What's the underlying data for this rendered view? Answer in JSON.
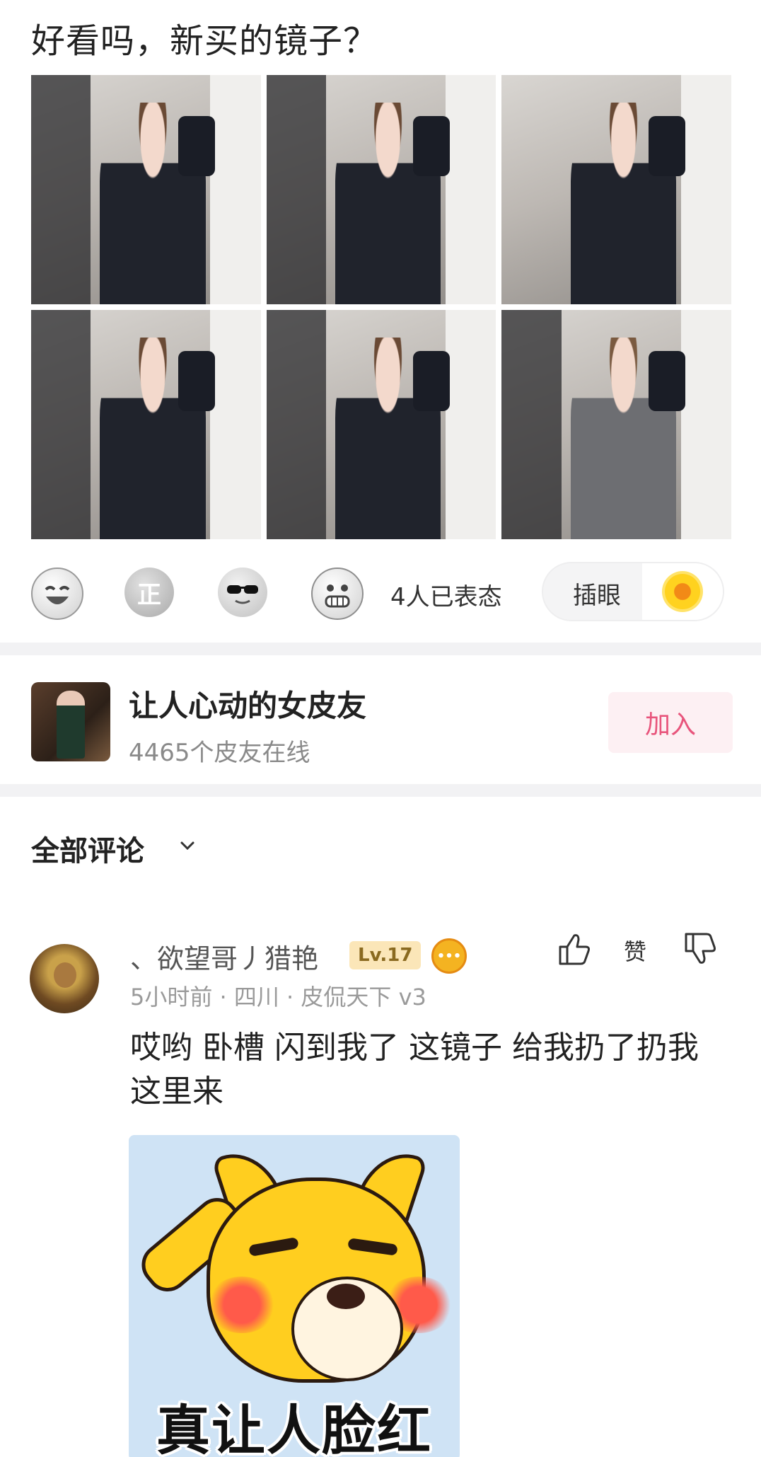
{
  "post": {
    "title": "好看吗，新买的镜子？",
    "photos": [
      "mirror-selfie",
      "mirror-selfie",
      "mirror-selfie",
      "mirror-selfie",
      "mirror-selfie",
      "mirror-selfie"
    ]
  },
  "reactions": {
    "emojis": [
      "laugh-emoji",
      "zheng-emoji",
      "cool-sunglasses-emoji",
      "grin-emoji"
    ],
    "zheng_glyph": "正",
    "count_text": "4人已表态",
    "chip_label": "插眼",
    "chip_icon": "sunflower-icon"
  },
  "group": {
    "name": "让人心动的女皮友",
    "online_text": "4465个皮友在线",
    "join_label": "加入",
    "join_color": "#e8557c"
  },
  "comments": {
    "header": "全部评论",
    "items": [
      {
        "user": "、欲望哥丿猎艳",
        "level": "Lv.17",
        "meta": "5小时前 · 四川 · 皮侃天下 v3",
        "like_label": "赞",
        "text": "哎哟  卧槽  闪到我了 这镜子  给我扔了扔我这里来",
        "sticker_caption": "真让人脸红"
      }
    ]
  }
}
